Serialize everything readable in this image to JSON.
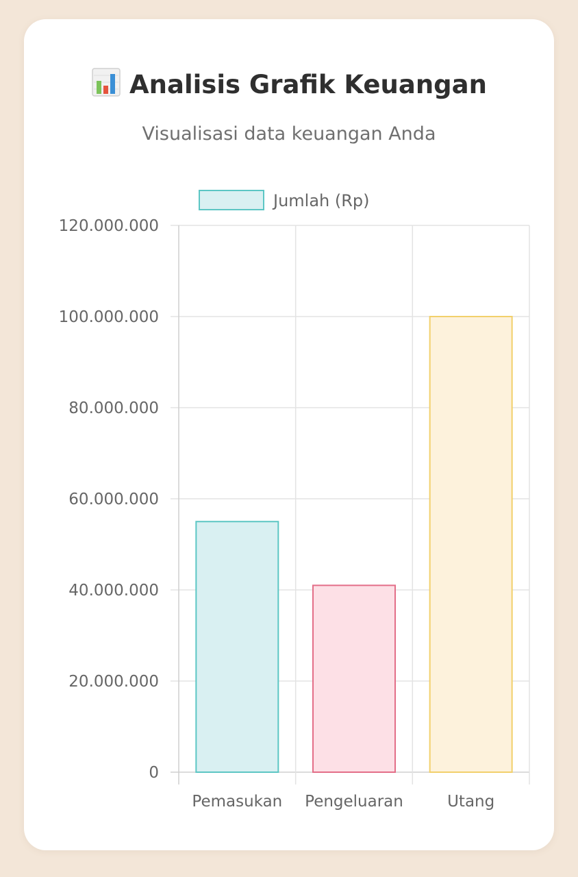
{
  "header": {
    "title": "Analisis Grafik Keuangan",
    "subtitle": "Visualisasi data keuangan Anda",
    "icon": "bar-chart-icon"
  },
  "chart_data": {
    "type": "bar",
    "categories": [
      "Pemasukan",
      "Pengeluaran",
      "Utang"
    ],
    "series": [
      {
        "name": "Jumlah (Rp)",
        "values": [
          55000000,
          41000000,
          100000000
        ]
      }
    ],
    "y_ticks": [
      "0",
      "20.000.000",
      "40.000.000",
      "60.000.000",
      "80.000.000",
      "100.000.000",
      "120.000.000"
    ],
    "ylim": [
      0,
      120000000
    ],
    "grid": true,
    "legend_position": "top",
    "bar_colors": {
      "fill": [
        "#d9f0f2",
        "#fde0e6",
        "#fdf2dc"
      ],
      "stroke": [
        "#5cc6c4",
        "#e36e88",
        "#f2d06b"
      ]
    },
    "legend_colors": {
      "fill": "#d9f0f2",
      "stroke": "#5cc6c4"
    }
  }
}
